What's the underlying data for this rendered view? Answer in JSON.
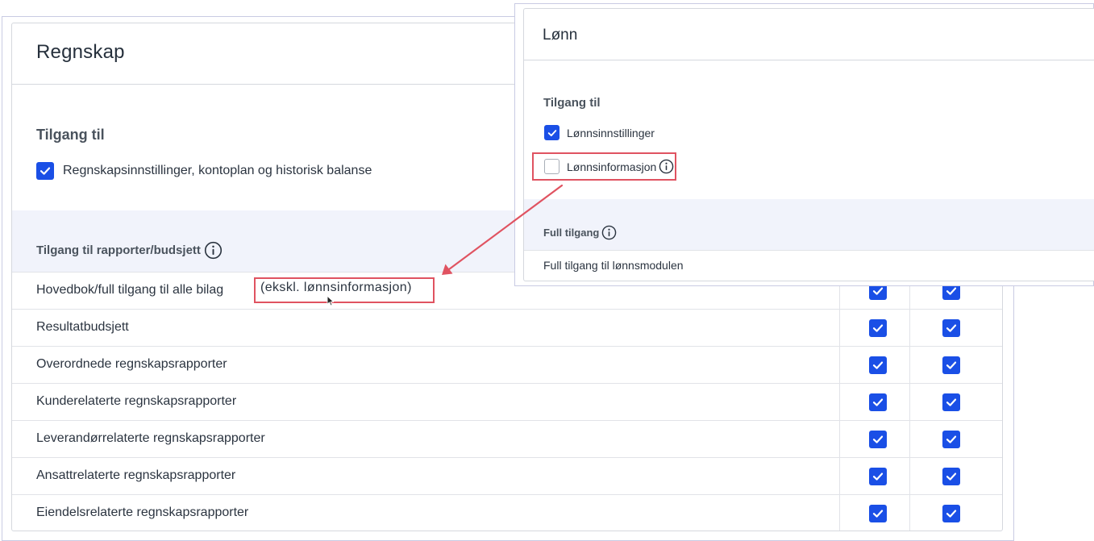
{
  "regnskap": {
    "title": "Regnskap",
    "access_section_title": "Tilgang til",
    "access_option": {
      "label": "Regnskapsinnstillinger, kontoplan og historisk balanse",
      "checked": true
    },
    "reports_section_title": "Tilgang til rapporter/budsjett",
    "rows": [
      {
        "label": "Hovedbok/full tilgang til alle bilag",
        "col1": true,
        "col2": true
      },
      {
        "label": "Resultatbudsjett",
        "col1": true,
        "col2": true
      },
      {
        "label": "Overordnede regnskapsrapporter",
        "col1": true,
        "col2": true
      },
      {
        "label": "Kunderelaterte regnskapsrapporter",
        "col1": true,
        "col2": true
      },
      {
        "label": "Leverandørrelaterte regnskapsrapporter",
        "col1": true,
        "col2": true
      },
      {
        "label": "Ansattrelaterte regnskapsrapporter",
        "col1": true,
        "col2": true
      },
      {
        "label": "Eiendelsrelaterte regnskapsrapporter",
        "col1": true,
        "col2": true
      }
    ],
    "exclusion_note": "(ekskl. lønnsinformasjon)"
  },
  "lonn": {
    "title": "Lønn",
    "access_section_title": "Tilgang til",
    "options": [
      {
        "label": "Lønnsinnstillinger",
        "checked": true
      },
      {
        "label": "Lønnsinformasjon",
        "checked": false
      }
    ],
    "full_access_title": "Full tilgang",
    "full_access_row": "Full tilgang til lønnsmodulen"
  },
  "colors": {
    "checkbox_blue": "#1a4fe6",
    "highlight_red": "#e05361",
    "band_background": "#f1f3fb"
  },
  "icons": [
    "checkbox-checked-icon",
    "checkbox-empty-icon",
    "info-icon",
    "mouse-cursor-icon",
    "annotation-arrow"
  ]
}
